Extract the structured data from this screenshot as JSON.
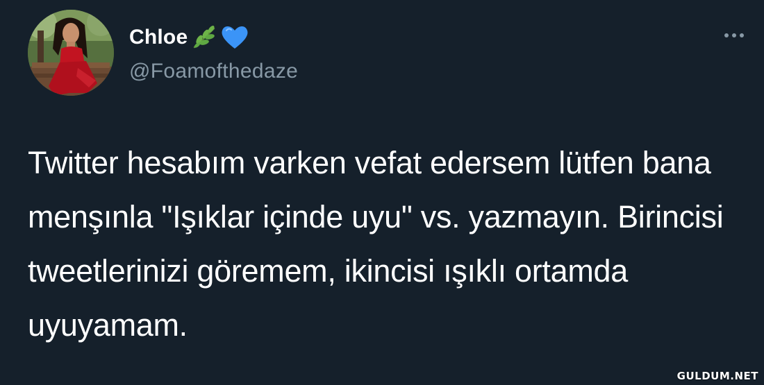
{
  "tweet": {
    "display_name": "Chloe",
    "name_emojis": [
      "herb-icon",
      "blue-heart-icon"
    ],
    "handle": "@Foamofthedaze",
    "text": "Twitter hesabım varken vefat edersem lütfen bana menşınla \"Işıklar içinde uyu\" vs. yazmayın. Birincisi tweetlerinizi göremem, ikincisi ışıklı ortamda uyuyamam."
  },
  "menu": {
    "icon": "more-horizontal-icon"
  },
  "watermark": {
    "text": "GULDUM.NET"
  },
  "colors": {
    "background": "#15202b",
    "text_primary": "#ffffff",
    "text_secondary": "#8899a6",
    "heart": "#3b94f7",
    "leaf": "#5fa843"
  }
}
